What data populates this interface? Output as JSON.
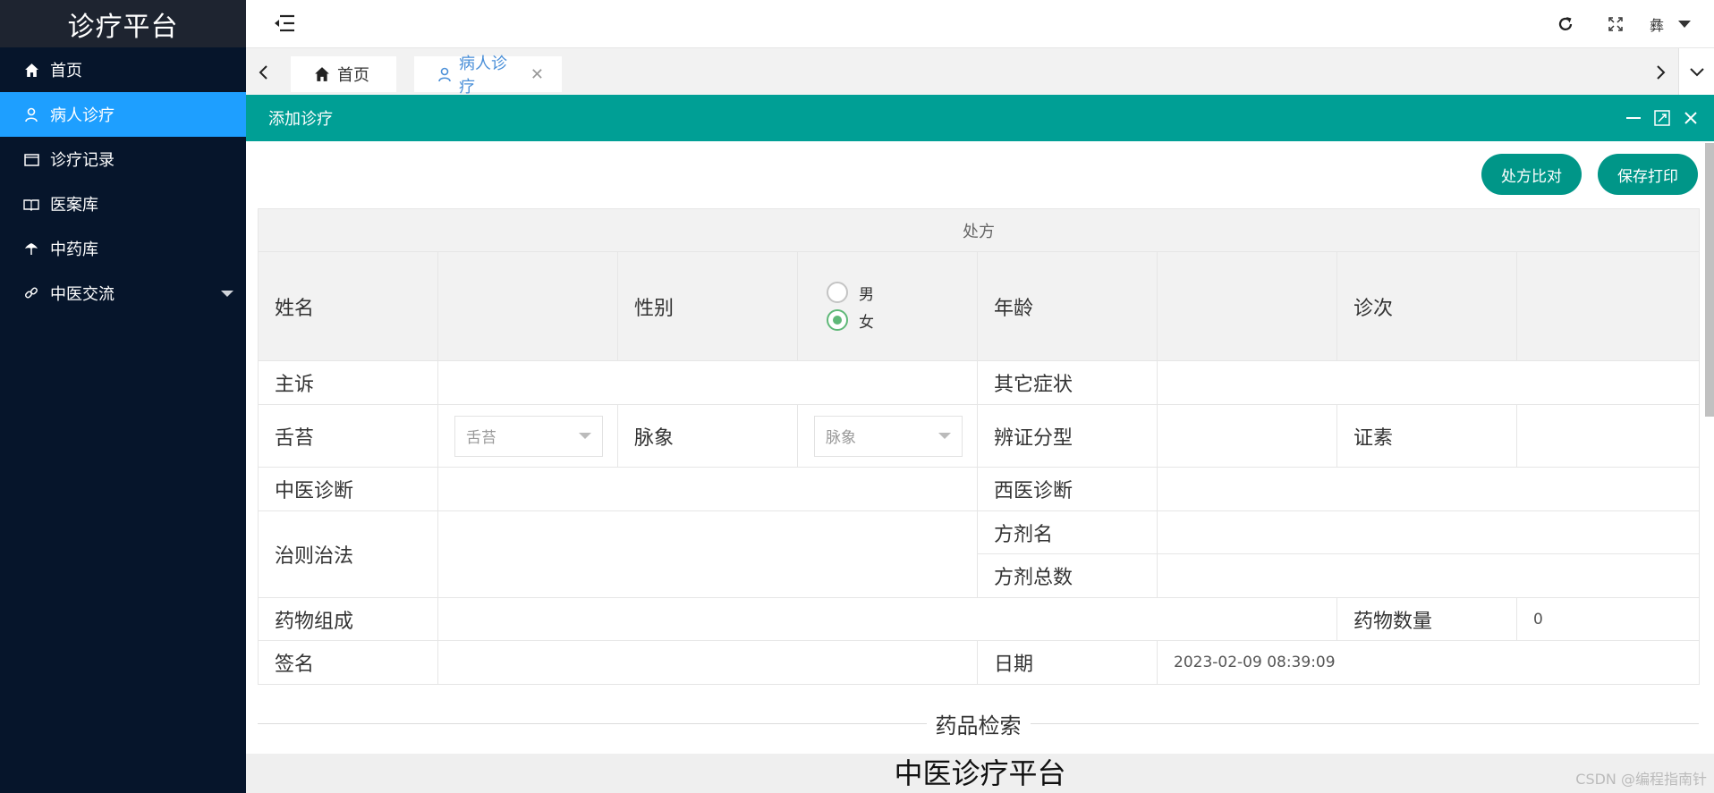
{
  "app": {
    "title": "诊疗平台"
  },
  "sidebar": {
    "items": [
      {
        "label": "首页",
        "icon": "home-icon"
      },
      {
        "label": "病人诊疗",
        "icon": "user-icon"
      },
      {
        "label": "诊疗记录",
        "icon": "folder-icon"
      },
      {
        "label": "医案库",
        "icon": "book-icon"
      },
      {
        "label": "中药库",
        "icon": "herb-icon"
      },
      {
        "label": "中医交流",
        "icon": "link-icon"
      }
    ],
    "active_index": 1
  },
  "header": {
    "user_glyph": "彝"
  },
  "tabs": {
    "items": [
      {
        "label": "首页",
        "icon": "home-icon"
      },
      {
        "label": "病人诊疗",
        "icon": "user-icon",
        "close": "✕"
      }
    ]
  },
  "panel": {
    "title": "添加诊疗",
    "buttons": {
      "compare": "处方比对",
      "save_print": "保存打印"
    }
  },
  "form": {
    "caption": "处方",
    "labels": {
      "name": "姓名",
      "gender": "性别",
      "age": "年龄",
      "visit_no": "诊次",
      "complaint": "主诉",
      "other_symptoms": "其它症状",
      "tongue": "舌苔",
      "pulse": "脉象",
      "syndrome_type": "辨证分型",
      "syndrome_element": "证素",
      "tcm_diagnosis": "中医诊断",
      "wm_diagnosis": "西医诊断",
      "treatment": "治则治法",
      "formula_name": "方剂名",
      "formula_total": "方剂总数",
      "composition": "药物组成",
      "drug_count": "药物数量",
      "signature": "签名",
      "date": "日期"
    },
    "gender_options": [
      "男",
      "女"
    ],
    "gender_selected": "女",
    "tongue_placeholder": "舌苔",
    "pulse_placeholder": "脉象",
    "values": {
      "drug_count": "0",
      "date": "2023-02-09 08:39:09"
    }
  },
  "section": {
    "drug_search": "药品检索"
  },
  "footer": {
    "text": "中医诊疗平台"
  },
  "watermark": "CSDN @编程指南针",
  "colors": {
    "sidebar_bg": "#06152b",
    "active": "#1e9fff",
    "teal": "#009688",
    "panel_header": "#009f95"
  }
}
